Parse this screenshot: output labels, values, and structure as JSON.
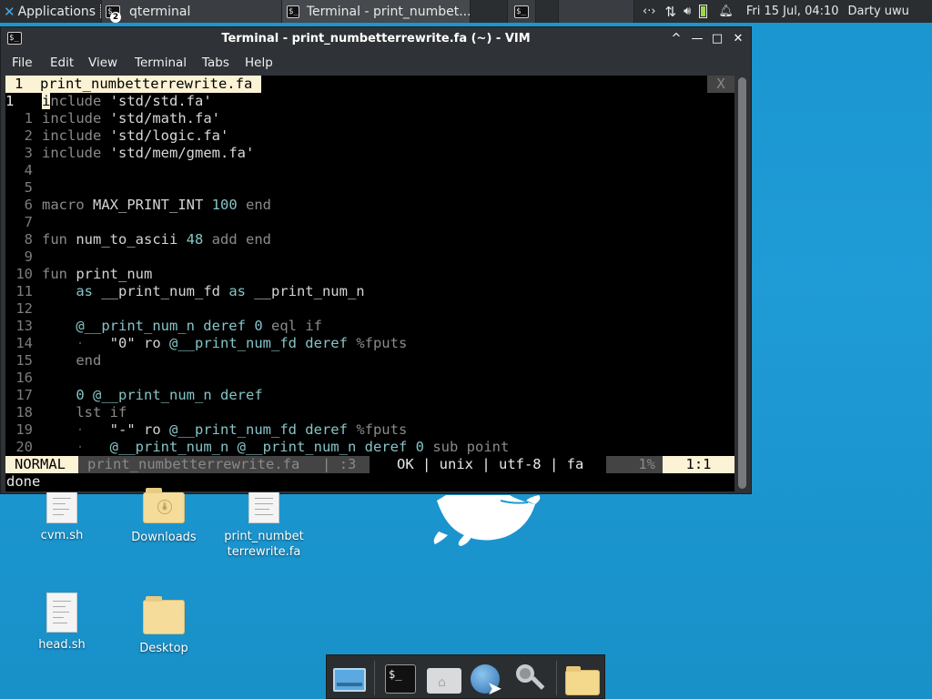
{
  "panel": {
    "apps_label": "Applications",
    "tasks": [
      {
        "label": "qterminal",
        "count": "2"
      },
      {
        "label": "Terminal - print_numbet..."
      }
    ],
    "clock": "Fri 15 Jul, 04:10",
    "user": "Darty uwu"
  },
  "window": {
    "title": "Terminal - print_numbetterrewrite.fa (~) - VIM",
    "buttons": {
      "up": "^",
      "min": "—",
      "max": "□",
      "close": "✕"
    },
    "menu": [
      "File",
      "Edit",
      "View",
      "Terminal",
      "Tabs",
      "Help"
    ]
  },
  "vim": {
    "tab_label": "1  print_numbetterrewrite.fa",
    "tab_close": "X",
    "status": {
      "mode": "NORMAL",
      "file": "print_numbetterrewrite.fa",
      "sep": "|",
      "line": ":3",
      "ok": "OK | unix | utf-8 | fa",
      "percent": "1%",
      "pos": "1:1"
    },
    "cmdline": "done"
  },
  "desktop": {
    "icons": [
      "cvm.sh",
      "Downloads",
      "print_numbetterrewrite.fa",
      "head.sh",
      "Desktop"
    ]
  },
  "colors": {
    "desktop": "#1f9bd6",
    "panel": "#2b2e31",
    "tab_bg": "#fcf3d6",
    "number": "#86c4c6"
  }
}
